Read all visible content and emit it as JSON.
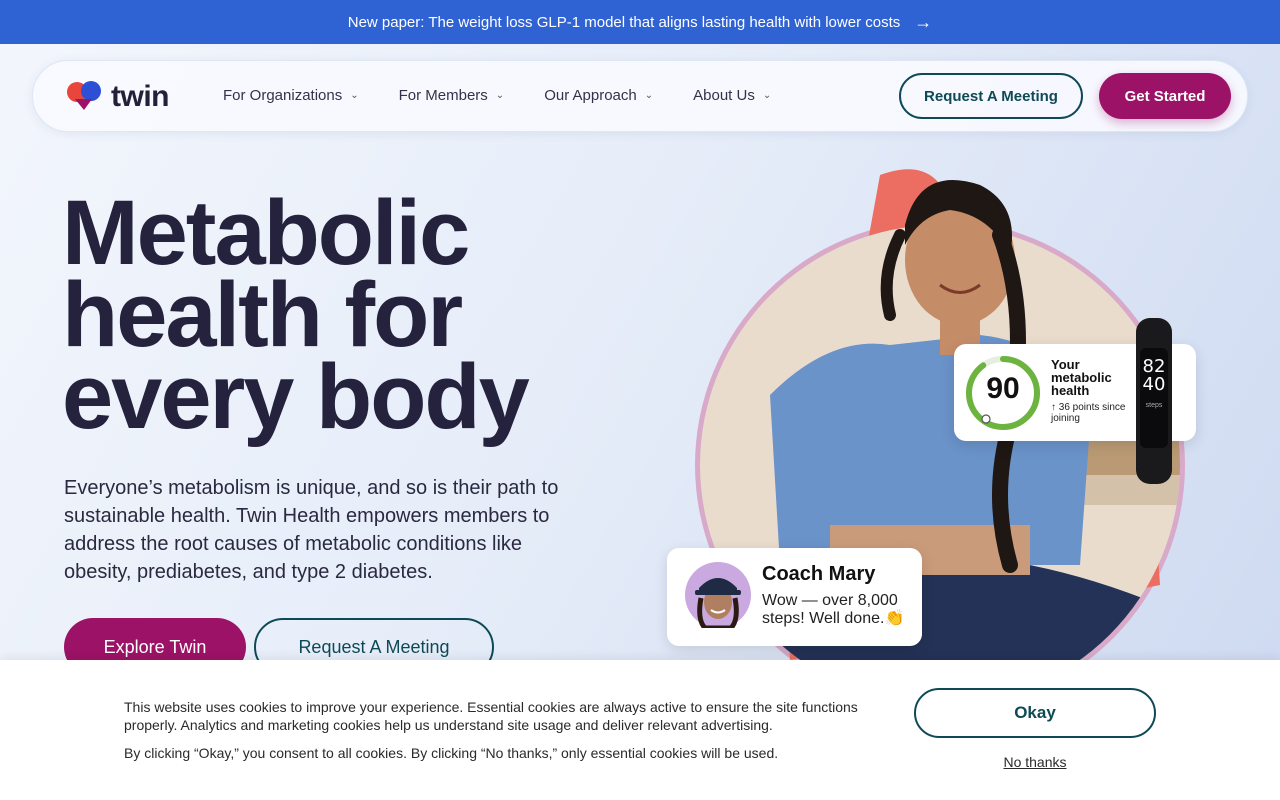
{
  "announcement": {
    "text": "New paper: The weight loss GLP-1 model that aligns lasting health with lower costs",
    "icon": "arrow-right-icon"
  },
  "nav": {
    "logo_text": "twin",
    "items": [
      {
        "label": "For Organizations"
      },
      {
        "label": "For Members"
      },
      {
        "label": "Our Approach"
      },
      {
        "label": "About Us"
      }
    ],
    "request_label": "Request A Meeting",
    "get_started_label": "Get Started"
  },
  "hero": {
    "headline_lines": [
      "Metabolic",
      "health for",
      "every body"
    ],
    "subtext": "Everyone’s metabolism is unique, and so is their path to sustainable health. Twin Health empowers members to address the root causes of metabolic conditions like obesity, prediabetes, and type 2 diabetes.",
    "explore_label": "Explore Twin",
    "request_label": "Request A Meeting"
  },
  "score_card": {
    "score": "90",
    "score_fraction": 0.9,
    "title": "Your metabolic health",
    "points": "↑ 36 points since joining"
  },
  "tracker": {
    "line1": "82",
    "line2": "40",
    "label": "steps"
  },
  "coach_card": {
    "name": "Coach Mary",
    "message": "Wow — over 8,000 steps! Well done.👏"
  },
  "cookie": {
    "text": "This website uses cookies to improve your experience. Essential cookies are always active to ensure the site functions properly. Analytics and marketing cookies help us understand site usage and deliver relevant advertising.",
    "consent_text": "By clicking “Okay,” you consent to all cookies. By clicking “No thanks,” only essential cookies will be used.",
    "okay_label": "Okay",
    "no_thanks_label": "No thanks"
  },
  "colors": {
    "brand_primary": "#9c1266",
    "brand_teal": "#0e4a55",
    "announce_blue": "#2f62d3"
  }
}
